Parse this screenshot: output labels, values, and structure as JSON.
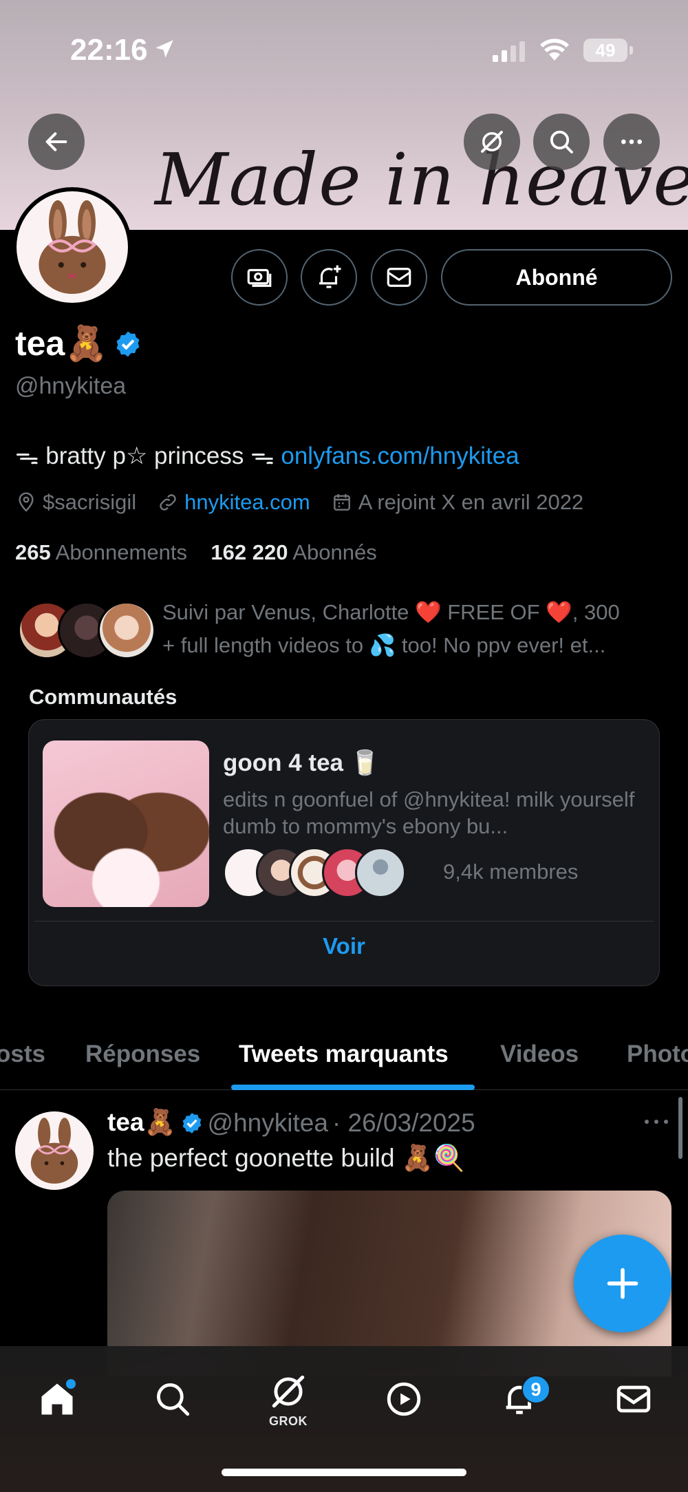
{
  "status_bar": {
    "time": "22:16",
    "battery": "49"
  },
  "banner": {
    "text": "Made in heaven"
  },
  "profile": {
    "follow_label": "Abonné",
    "name": "tea🧸",
    "handle": "@hnykitea",
    "bio_text": "ᯓ bratty p☆ princess ᯓ ",
    "bio_link": "onlyfans.com/hnykitea",
    "location": "$sacrisigil",
    "website": "hnykitea.com",
    "joined": "A rejoint X en avril 2022",
    "following_count": "265",
    "following_label": "Abonnements",
    "followers_count": "162 220",
    "followers_label": "Abonnés",
    "followed_by_line1": "Suivi par Venus, Charlotte ❤️  FREE OF ❤️, 300",
    "followed_by_line2": "+ full length videos to 💦 too! No ppv ever! et..."
  },
  "communities": {
    "title": "Communautés",
    "card": {
      "name": "goon 4 tea 🥛",
      "description": "edits n goonfuel of @hnykitea! milk yourself dumb to mommy's ebony bu...",
      "members": "9,4k membres",
      "view_label": "Voir"
    }
  },
  "tabs": [
    "osts",
    "Réponses",
    "Tweets marquants",
    "Videos",
    "Photo"
  ],
  "tweet": {
    "name": "tea🧸",
    "handle": "@hnykitea",
    "date": "· 26/03/2025",
    "text": "the perfect goonette build 🧸🍭"
  },
  "bottom_nav": {
    "grok_label": "GROK",
    "notifications_badge": "9"
  },
  "colors": {
    "accent": "#1d9bf0",
    "background": "#000000",
    "muted": "#71767b"
  }
}
